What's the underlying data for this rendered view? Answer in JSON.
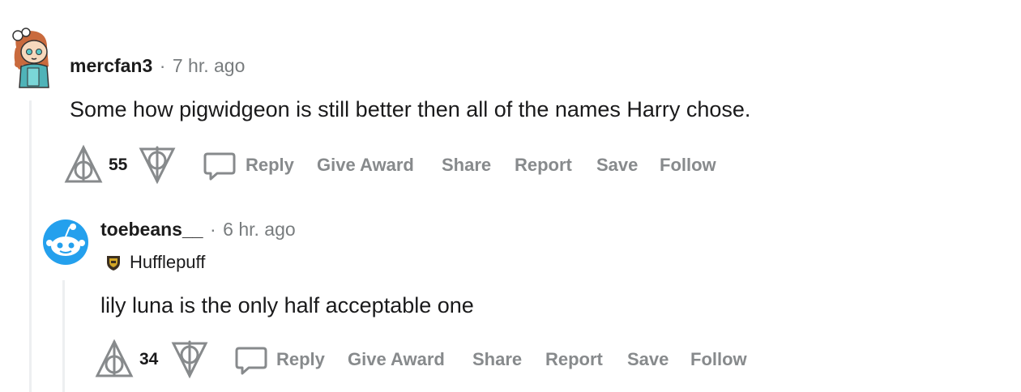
{
  "comments": [
    {
      "author": "mercfan3",
      "separator": "·",
      "time": "7 hr. ago",
      "body": "Some how pigwidgeon is still better then all of the names Harry chose.",
      "score": "55",
      "actions": {
        "reply": "Reply",
        "award": "Give Award",
        "share": "Share",
        "report": "Report",
        "save": "Save",
        "follow": "Follow"
      }
    },
    {
      "author": "toebeans__",
      "separator": "·",
      "time": "6 hr. ago",
      "flair": "Hufflepuff",
      "body": "lily luna is the only half acceptable one",
      "score": "34",
      "actions": {
        "reply": "Reply",
        "award": "Give Award",
        "share": "Share",
        "report": "Report",
        "save": "Save",
        "follow": "Follow"
      }
    }
  ],
  "colors": {
    "muted": "#878a8c",
    "thread_line": "#edeff1",
    "snoo_blue": "#24a0ed"
  }
}
